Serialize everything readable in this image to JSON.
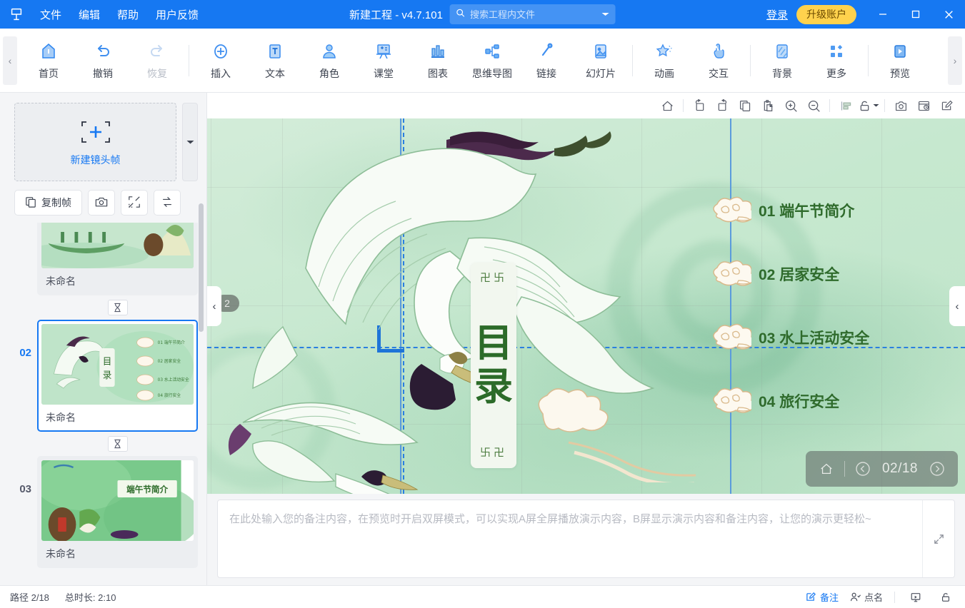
{
  "titlebar": {
    "logo": "logo-icon",
    "menus": [
      {
        "label": "文件"
      },
      {
        "label": "编辑"
      },
      {
        "label": "帮助"
      },
      {
        "label": "用户反馈"
      }
    ],
    "project_title": "新建工程 - v4.7.101",
    "search_placeholder": "搜索工程内文件",
    "search_value": "",
    "login_label": "登录",
    "upgrade_label": "升级账户",
    "window": {
      "minimize": "minimize-icon",
      "maximize": "maximize-icon",
      "close": "close-icon"
    },
    "accent_bg": "#1678f2",
    "upgrade_bg": "#ffd24d"
  },
  "toolbar": {
    "scroll_left": "‹",
    "scroll_right": "›",
    "items": [
      {
        "label": "首页",
        "icon": "home-icon",
        "disabled": false
      },
      {
        "label": "撤销",
        "icon": "undo-icon",
        "disabled": false
      },
      {
        "label": "恢复",
        "icon": "redo-icon",
        "disabled": true
      },
      {
        "sep": true
      },
      {
        "label": "插入",
        "icon": "plus-circle-icon",
        "disabled": false
      },
      {
        "label": "文本",
        "icon": "text-icon",
        "disabled": false
      },
      {
        "label": "角色",
        "icon": "role-icon",
        "disabled": false
      },
      {
        "label": "课堂",
        "icon": "classroom-icon",
        "disabled": false
      },
      {
        "label": "图表",
        "icon": "chart-icon",
        "disabled": false
      },
      {
        "label": "思维导图",
        "icon": "mindmap-icon",
        "disabled": false
      },
      {
        "label": "链接",
        "icon": "link-icon",
        "disabled": false
      },
      {
        "label": "幻灯片",
        "icon": "slide-icon",
        "disabled": false
      },
      {
        "sep": true
      },
      {
        "label": "动画",
        "icon": "animation-icon",
        "disabled": false
      },
      {
        "label": "交互",
        "icon": "interaction-icon",
        "disabled": false
      },
      {
        "sep": true
      },
      {
        "label": "背景",
        "icon": "background-icon",
        "disabled": false
      },
      {
        "label": "更多",
        "icon": "more-icon",
        "disabled": false
      },
      {
        "sep": true
      },
      {
        "label": "预览",
        "icon": "preview-icon",
        "disabled": false
      }
    ]
  },
  "sidebar": {
    "new_frame_label": "新建镜头帧",
    "new_frame_dropdown": "chevron-down-icon",
    "actions": [
      {
        "label": "复制帧",
        "icon": "copy-frame-icon",
        "type": "wide"
      },
      {
        "label": "",
        "icon": "camera-icon",
        "type": "square"
      },
      {
        "label": "",
        "icon": "fit-frame-icon",
        "type": "square"
      },
      {
        "label": "",
        "icon": "swap-order-icon",
        "type": "square"
      }
    ],
    "slides": [
      {
        "num": "",
        "name": "未命名",
        "selected": false,
        "kind": "dragon-boat"
      },
      {
        "num": "02",
        "name": "未命名",
        "selected": true,
        "kind": "toc-crane"
      },
      {
        "num": "03",
        "name": "未命名",
        "selected": false,
        "kind": "intro"
      }
    ],
    "timer_icon": "hourglass-icon"
  },
  "canvas_toolbar": {
    "buttons": [
      {
        "icon": "home-outline-icon",
        "name": "canvas-home"
      },
      {
        "sep": true
      },
      {
        "icon": "rotate-left-icon",
        "name": "rotate-left"
      },
      {
        "icon": "rotate-right-icon",
        "name": "rotate-right"
      },
      {
        "icon": "copy-icon",
        "name": "copy"
      },
      {
        "icon": "paste-icon",
        "name": "paste"
      },
      {
        "icon": "zoom-in-icon",
        "name": "zoom-in"
      },
      {
        "icon": "zoom-out-icon",
        "name": "zoom-out"
      },
      {
        "sep": true
      },
      {
        "icon": "align-icon",
        "name": "align"
      },
      {
        "icon": "lock-icon",
        "name": "lock",
        "has_caret": true
      },
      {
        "sep": true
      },
      {
        "icon": "snapshot-icon",
        "name": "snapshot"
      },
      {
        "icon": "history-icon",
        "name": "history"
      },
      {
        "icon": "edit-icon",
        "name": "edit"
      }
    ]
  },
  "canvas": {
    "frame_badge": "2",
    "toc_card": {
      "top_ornament": "卍卐",
      "chars": [
        "目",
        "录"
      ],
      "bottom_ornament": "卐卍"
    },
    "toc_items": [
      {
        "num": "01",
        "text": "端午节简介"
      },
      {
        "num": "02",
        "text": "居家安全"
      },
      {
        "num": "03",
        "text": "水上活动安全"
      },
      {
        "num": "04",
        "text": "旅行安全"
      }
    ],
    "toc_text_color": "#2f6b2c",
    "page_nav": {
      "home_icon": "home-outline-icon",
      "prev_icon": "chevron-left-circle-icon",
      "page_label": "02/18",
      "next_icon": "chevron-right-circle-icon"
    },
    "collapse_left": "‹",
    "collapse_right": "‹"
  },
  "notes": {
    "placeholder": "在此处输入您的备注内容，在预览时开启双屏模式，可以实现A屏全屏播放演示内容，B屏显示演示内容和备注内容，让您的演示更轻松~",
    "value": "",
    "expand_icon": "expand-icon"
  },
  "statusbar": {
    "path_label": "路径 2/18",
    "duration_label": "总时长: 2:10",
    "notes_button": {
      "label": "备注",
      "icon": "notes-icon",
      "active": true
    },
    "rollcall_button": {
      "label": "点名",
      "icon": "rollcall-icon",
      "active": false
    },
    "present_icon": "present-icon",
    "lock-icon": "lock-bottom-icon",
    "active_color": "#1678f2"
  }
}
